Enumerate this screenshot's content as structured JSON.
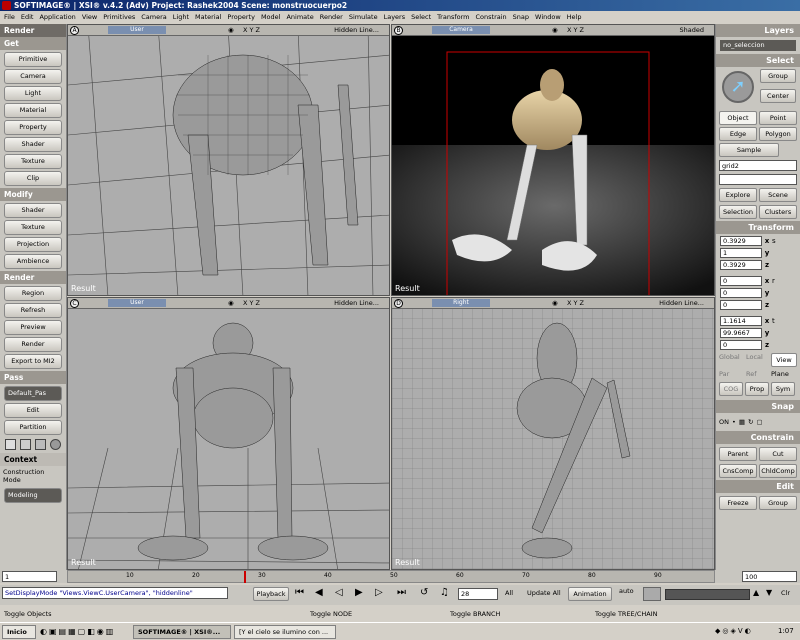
{
  "window": {
    "title": "SOFTIMAGE® | XSI® v.4.2 (Adv) Project: Rashek2004    Scene: monstruocuerpo2"
  },
  "menu": [
    "File",
    "Edit",
    "Application",
    "View",
    "Primitives",
    "Camera",
    "Light",
    "Material",
    "Property",
    "Model",
    "Animate",
    "Render",
    "Simulate",
    "Layers",
    "Select",
    "Transform",
    "Constrain",
    "Snap",
    "Window",
    "Help"
  ],
  "left_panel": {
    "render_tab": "Render",
    "get": {
      "label": "Get",
      "buttons": [
        "Primitive",
        "Camera",
        "Light",
        "Material",
        "Property",
        "Shader",
        "Texture",
        "Clip"
      ]
    },
    "modify": {
      "label": "Modify",
      "buttons": [
        "Shader",
        "Texture",
        "Projection",
        "Ambience"
      ]
    },
    "render": {
      "label": "Render",
      "buttons": [
        "Region",
        "Refresh",
        "Preview",
        "Render",
        "Export to MI2"
      ]
    },
    "pass": {
      "label": "Pass",
      "dropdown": "Default_Pas",
      "buttons": [
        "Edit",
        "Partition"
      ]
    },
    "context": {
      "label": "Context",
      "mode_label": "Construction Mode",
      "mode_value": "Modeling"
    }
  },
  "viewports": {
    "a": {
      "letter": "A",
      "camera": "User",
      "mode": "Hidden Line...",
      "axes": "X Y Z",
      "result": "Result"
    },
    "b": {
      "letter": "B",
      "camera": "Camera",
      "mode": "Shaded",
      "axes": "X Y Z",
      "result": "Result"
    },
    "c": {
      "letter": "C",
      "camera": "User",
      "mode": "Hidden Line...",
      "axes": "X Y Z",
      "result": "Result"
    },
    "d": {
      "letter": "D",
      "camera": "Right",
      "mode": "Hidden Line...",
      "axes": "X Y Z",
      "result": "Result"
    }
  },
  "right_panel": {
    "layers": {
      "label": "Layers",
      "dropdown": "no_seleccion"
    },
    "select": {
      "label": "Select",
      "buttons": [
        "Group",
        "Center",
        "Object",
        "Point",
        "Edge",
        "Polygon",
        "Sample"
      ],
      "name_field": "grid2",
      "buttons2": [
        "Explore",
        "Scene",
        "Selection",
        "Clusters"
      ]
    },
    "transform": {
      "label": "Transform",
      "s": [
        "0.3929",
        "1",
        "0.3929"
      ],
      "r": [
        "0",
        "0",
        "0"
      ],
      "t": [
        "1.1614",
        "99.9667",
        "0"
      ],
      "ref_buttons": [
        "Global",
        "Local",
        "View",
        "Par",
        "Ref",
        "Plane"
      ],
      "cog_buttons": [
        "COG",
        "Prop",
        "Sym"
      ]
    },
    "snap": {
      "label": "Snap",
      "on": "ON"
    },
    "constrain": {
      "label": "Constrain",
      "buttons": [
        "Parent",
        "Cut",
        "CnsComp",
        "ChldComp"
      ]
    },
    "edit": {
      "label": "Edit",
      "buttons": [
        "Freeze",
        "Group"
      ]
    }
  },
  "timeline": {
    "start": "1",
    "end": "100",
    "ticks": [
      "10",
      "20",
      "30",
      "40",
      "50",
      "60",
      "70",
      "80",
      "90"
    ],
    "current_frame": 28
  },
  "playback": {
    "command": "SetDisplayMode \"Views.ViewC.UserCamera\", \"hiddenline\"",
    "playback_label": "Playback",
    "frame": "28",
    "all_label": "All",
    "update_label": "Update All",
    "animation_label": "Animation",
    "auto_label": "auto",
    "clr_label": "Clr"
  },
  "status": {
    "left": "Toggle Objects",
    "mid1": "Toggle NODE",
    "mid2": "Toggle BRANCH",
    "right": "Toggle TREE/CHAIN"
  },
  "taskbar": {
    "start": "Inicio",
    "task1": "SOFTIMAGE® | XSI®...",
    "task2": "[Y el cielo se ilumino con ...",
    "clock": "1:07"
  },
  "colors": {
    "title_start": "#0a246a",
    "title_end": "#3a6ea5",
    "viewport_bg": "#adadad",
    "section_header": "#9b9790",
    "frame_marker": "#cc0000",
    "camera_frame": "#cc0000"
  }
}
